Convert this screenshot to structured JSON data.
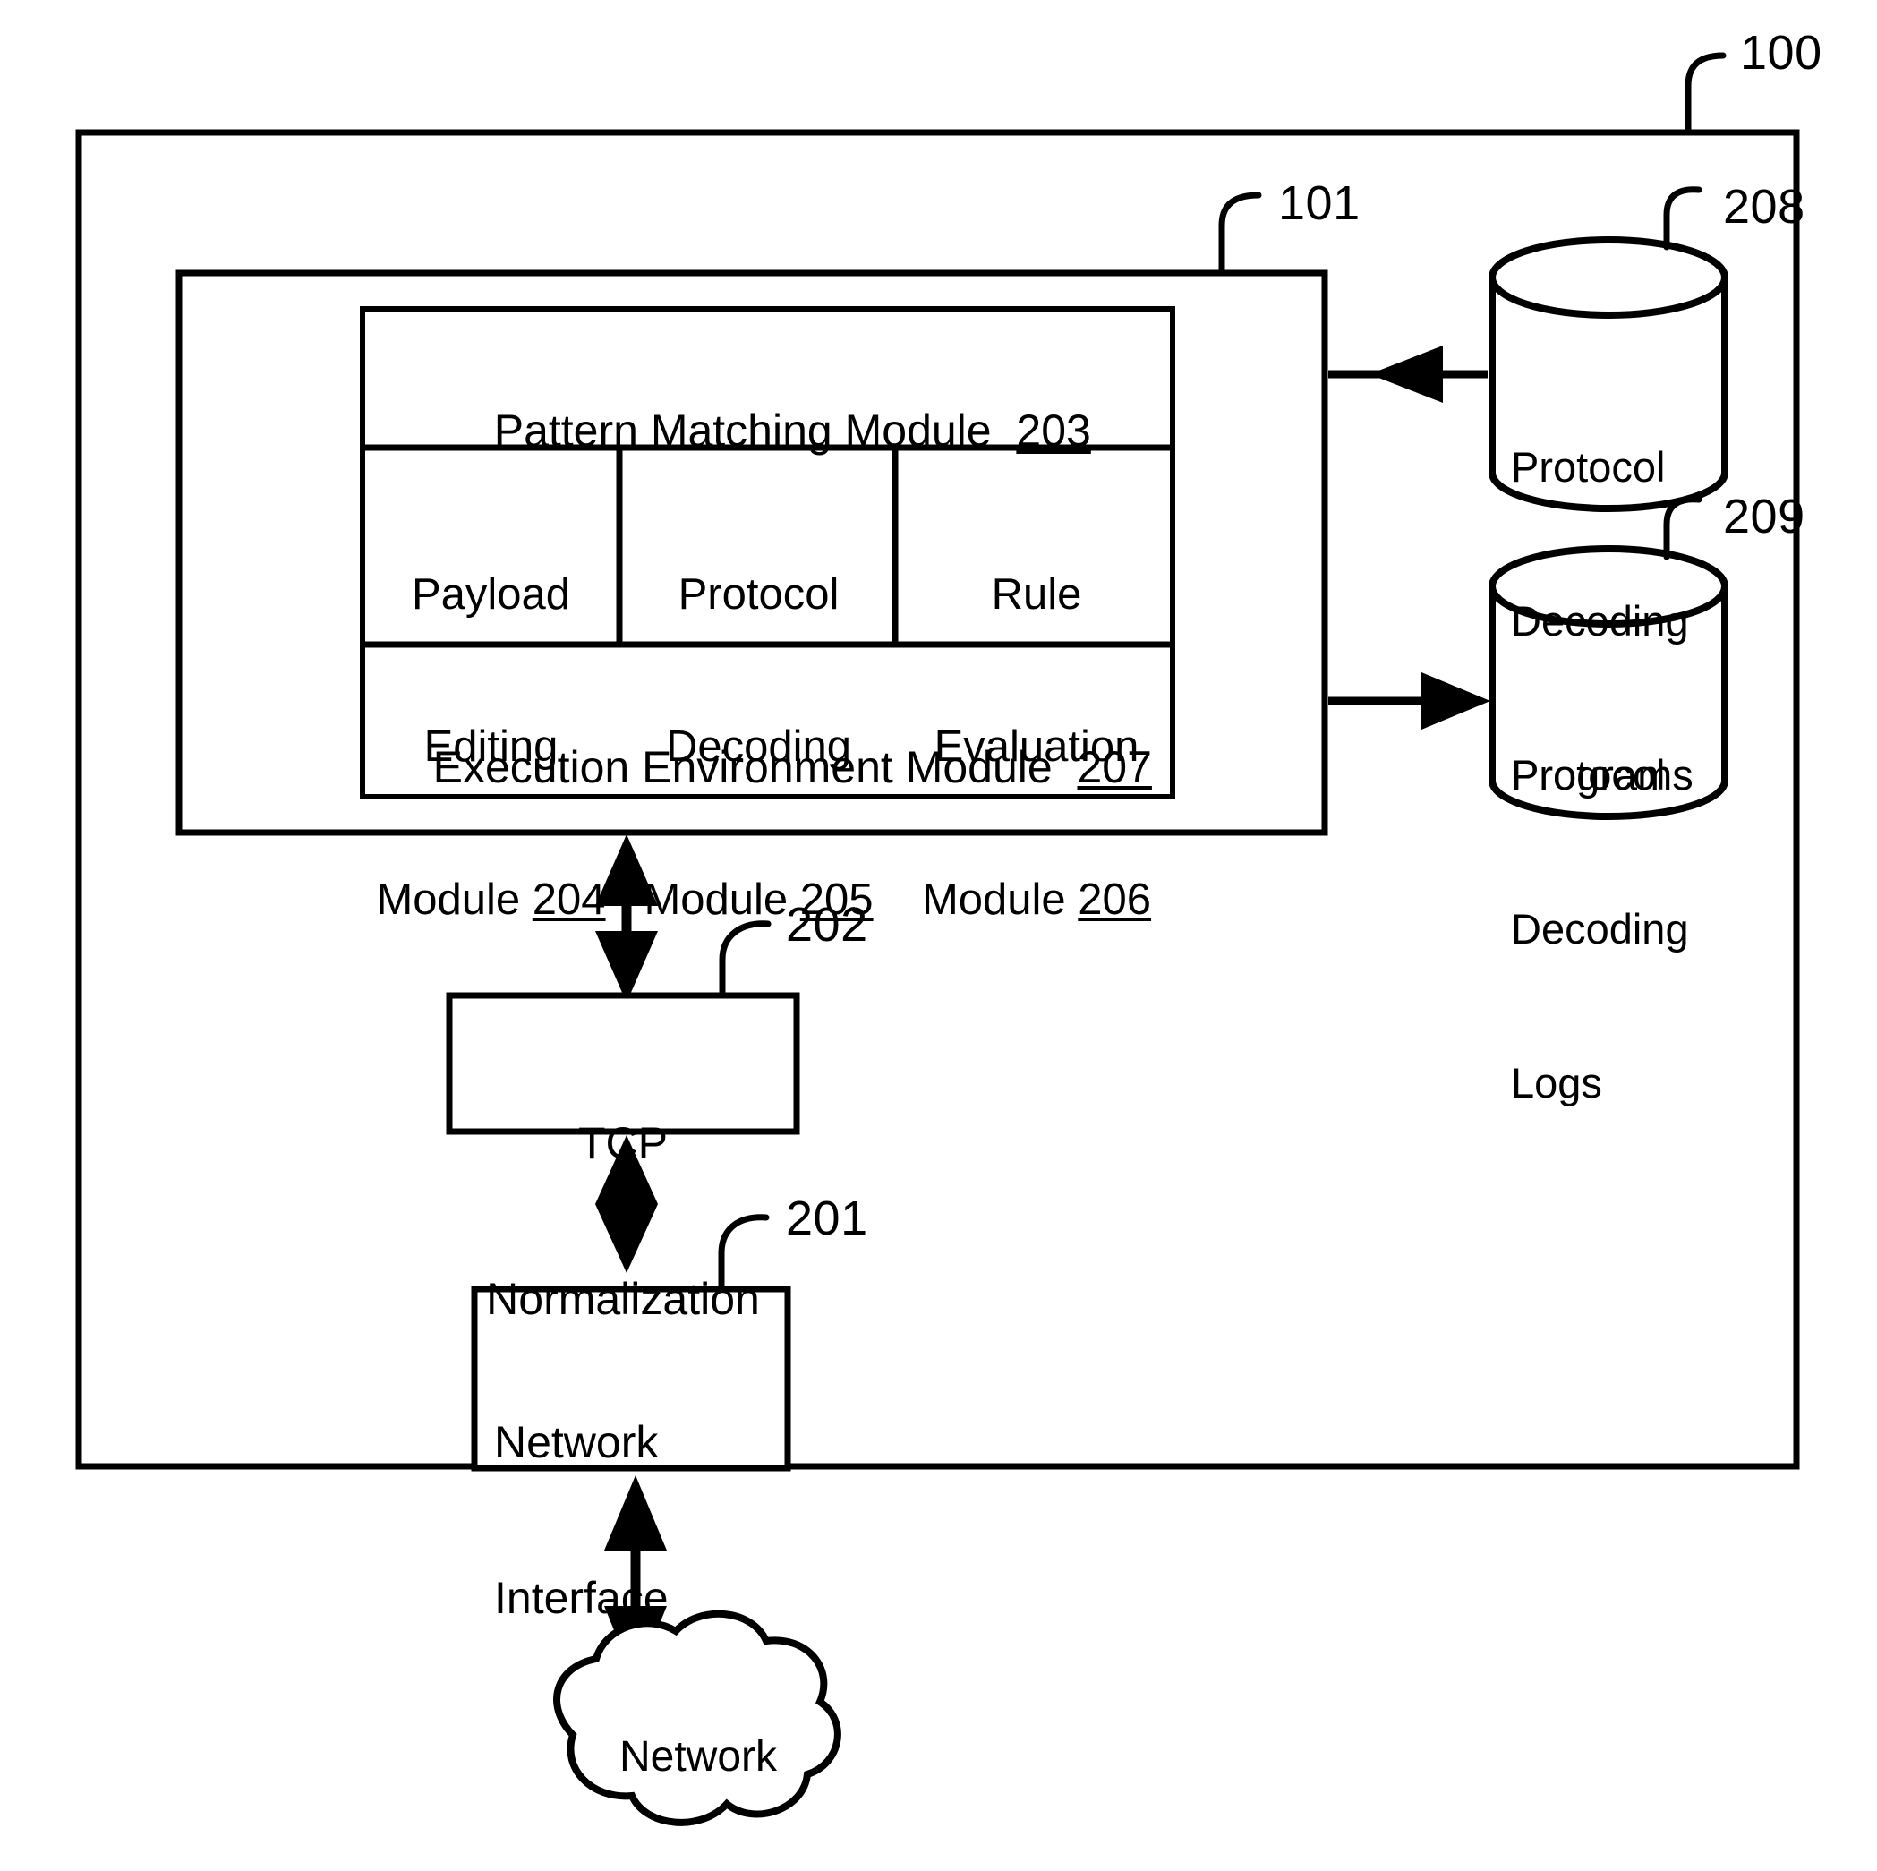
{
  "figure": {
    "system_ref": "100",
    "engine_ref": "101"
  },
  "engine": {
    "pattern_matching": {
      "label": "Pattern Matching Module",
      "ref": "203"
    },
    "payload_editing": {
      "line1": "Payload",
      "line2": "Editing",
      "line3": "Module",
      "ref": "204"
    },
    "protocol_decoding": {
      "line1": "Protocol",
      "line2": "Decoding",
      "line3": "Module",
      "ref": "205"
    },
    "rule_evaluation": {
      "line1": "Rule",
      "line2": "Evaluation",
      "line3": "Module",
      "ref": "206"
    },
    "execution_environment": {
      "label": "Execution Environment Module",
      "ref": "207"
    }
  },
  "datastores": [
    {
      "name": "protocol-decoding-programs",
      "line1": "Protocol",
      "line2": "Decoding",
      "line3": "Programs",
      "ref": "208",
      "flow": "into-engine"
    },
    {
      "name": "protocol-decoding-logs",
      "line1": "Protocol",
      "line2": "Decoding",
      "line3": "Logs",
      "ref": "209",
      "flow": "from-engine"
    }
  ],
  "stages": {
    "tcp_normalization": {
      "line1": "TCP",
      "line2": "Normalization",
      "ref": "202"
    },
    "network_interface": {
      "line1": "Network",
      "line2": "Interface",
      "ref": "201"
    },
    "network_cloud": {
      "label": "Network"
    }
  },
  "colors": {
    "stroke": "#000000",
    "background": "#ffffff",
    "text": "#000000"
  }
}
